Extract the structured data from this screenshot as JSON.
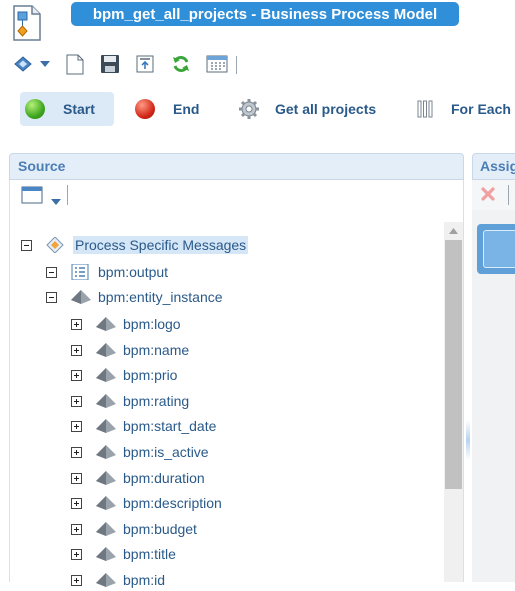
{
  "window": {
    "title": "bpm_get_all_projects - Business Process Model"
  },
  "main_toolbar": {
    "start": "Start",
    "end": "End",
    "get_all_projects": "Get all projects",
    "for_each": "For Each"
  },
  "source_panel": {
    "title": "Source",
    "tree": {
      "root": "Process Specific Messages",
      "output": "bpm:output",
      "entity_instance": "bpm:entity_instance",
      "fields": [
        "bpm:logo",
        "bpm:name",
        "bpm:prio",
        "bpm:rating",
        "bpm:start_date",
        "bpm:is_active",
        "bpm:duration",
        "bpm:description",
        "bpm:budget",
        "bpm:title",
        "bpm:id"
      ]
    }
  },
  "assign_panel": {
    "title": "Assig"
  },
  "colors": {
    "title_bar": "#2f8fd8",
    "text": "#2a5a8a",
    "panel_header": "#e4eef8",
    "start_green": "#3fa81f",
    "end_red": "#d42a1a"
  }
}
